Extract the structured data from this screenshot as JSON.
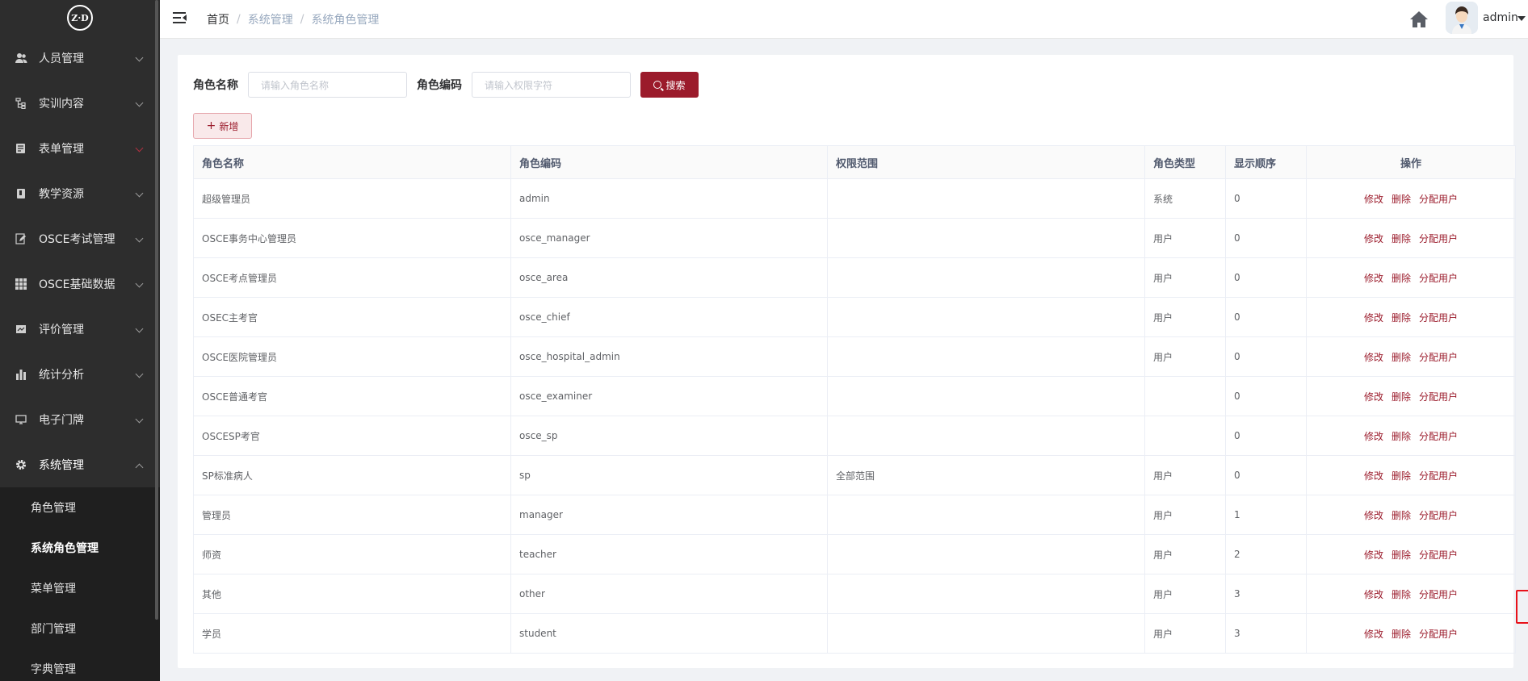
{
  "sidebar": {
    "logo_text": "Z·D",
    "menu": [
      {
        "label": "人员管理",
        "icon": "users-icon"
      },
      {
        "label": "实训内容",
        "icon": "tree-icon"
      },
      {
        "label": "表单管理",
        "icon": "form-icon"
      },
      {
        "label": "教学资源",
        "icon": "book-icon"
      },
      {
        "label": "OSCE考试管理",
        "icon": "edit-icon"
      },
      {
        "label": "OSCE基础数据",
        "icon": "grid-icon"
      },
      {
        "label": "评价管理",
        "icon": "chart-box-icon"
      },
      {
        "label": "统计分析",
        "icon": "bar-chart-icon"
      },
      {
        "label": "电子门牌",
        "icon": "monitor-icon"
      },
      {
        "label": "系统管理",
        "icon": "gear-icon"
      }
    ],
    "submenu": [
      {
        "label": "角色管理"
      },
      {
        "label": "系统角色管理"
      },
      {
        "label": "菜单管理"
      },
      {
        "label": "部门管理"
      },
      {
        "label": "字典管理"
      }
    ]
  },
  "navbar": {
    "breadcrumb": [
      "首页",
      "系统管理",
      "系统角色管理"
    ],
    "user": "admin"
  },
  "search": {
    "role_name_label": "角色名称",
    "role_name_placeholder": "请输入角色名称",
    "role_code_label": "角色编码",
    "role_code_placeholder": "请输入权限字符",
    "search_button": "搜索",
    "add_button": "新增"
  },
  "table": {
    "columns": [
      "角色名称",
      "角色编码",
      "权限范围",
      "角色类型",
      "显示顺序",
      "操作"
    ],
    "actions": {
      "edit": "修改",
      "delete": "删除",
      "assign": "分配用户"
    },
    "rows": [
      {
        "name": "超级管理员",
        "code": "admin",
        "scope": "",
        "type": "系统",
        "order": "0"
      },
      {
        "name": "OSCE事务中心管理员",
        "code": "osce_manager",
        "scope": "",
        "type": "用户",
        "order": "0"
      },
      {
        "name": "OSCE考点管理员",
        "code": "osce_area",
        "scope": "",
        "type": "用户",
        "order": "0"
      },
      {
        "name": "OSEC主考官",
        "code": "osce_chief",
        "scope": "",
        "type": "用户",
        "order": "0"
      },
      {
        "name": "OSCE医院管理员",
        "code": "osce_hospital_admin",
        "scope": "",
        "type": "用户",
        "order": "0"
      },
      {
        "name": "OSCE普通考官",
        "code": "osce_examiner",
        "scope": "",
        "type": "",
        "order": "0"
      },
      {
        "name": "OSCESP考官",
        "code": "osce_sp",
        "scope": "",
        "type": "",
        "order": "0"
      },
      {
        "name": "SP标准病人",
        "code": "sp",
        "scope": "全部范围",
        "type": "用户",
        "order": "0"
      },
      {
        "name": "管理员",
        "code": "manager",
        "scope": "",
        "type": "用户",
        "order": "1"
      },
      {
        "name": "师资",
        "code": "teacher",
        "scope": "",
        "type": "用户",
        "order": "2"
      },
      {
        "name": "其他",
        "code": "other",
        "scope": "",
        "type": "用户",
        "order": "3"
      },
      {
        "name": "学员",
        "code": "student",
        "scope": "",
        "type": "用户",
        "order": "3"
      }
    ]
  }
}
